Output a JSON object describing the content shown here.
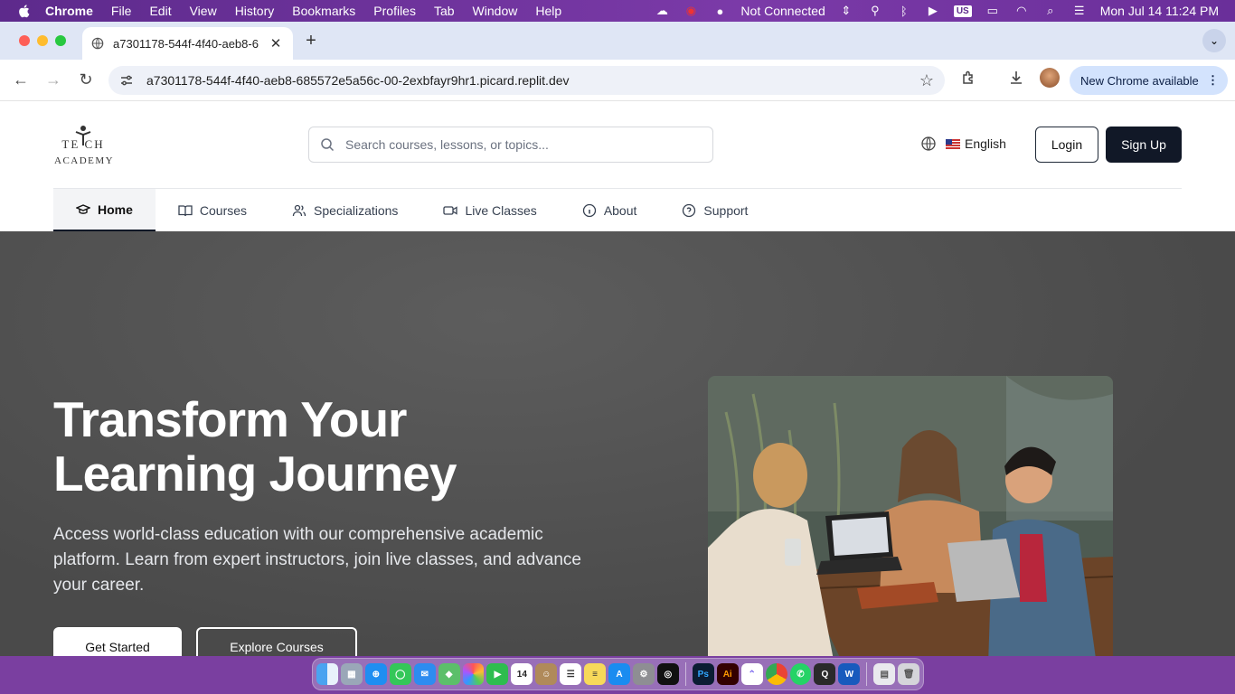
{
  "menubar": {
    "app_name": "Chrome",
    "items": [
      "File",
      "Edit",
      "View",
      "History",
      "Bookmarks",
      "Profiles",
      "Tab",
      "Window",
      "Help"
    ],
    "status_text": "Not Connected",
    "input_source": "US",
    "datetime": "Mon Jul 14  11:24 PM"
  },
  "browser": {
    "tab_title": "a7301178-544f-4f40-aeb8-6",
    "url": "a7301178-544f-4f40-aeb8-685572e5a56c-00-2exbfayr9hr1.picard.replit.dev",
    "update_label": "New Chrome available"
  },
  "site": {
    "logo_line1": "TE  CH",
    "logo_line2": "ACADEMY",
    "search_placeholder": "Search courses, lessons, or topics...",
    "language": "English",
    "login_label": "Login",
    "signup_label": "Sign Up",
    "nav": [
      {
        "label": "Home",
        "icon": "graduation-cap-icon",
        "active": true
      },
      {
        "label": "Courses",
        "icon": "book-icon"
      },
      {
        "label": "Specializations",
        "icon": "users-icon"
      },
      {
        "label": "Live Classes",
        "icon": "video-icon"
      },
      {
        "label": "About",
        "icon": "info-icon"
      },
      {
        "label": "Support",
        "icon": "help-circle-icon"
      }
    ]
  },
  "hero": {
    "title_line1": "Transform Your",
    "title_line2": "Learning Journey",
    "description": "Access world-class education with our comprehensive academic platform. Learn from expert instructors, join live classes, and advance your career.",
    "primary_cta": "Get Started",
    "secondary_cta": "Explore Courses",
    "image_icon": "students-photo"
  },
  "dock": {
    "apps": [
      "Finder",
      "Launchpad",
      "Safari",
      "Messages",
      "Mail",
      "Maps",
      "Photos",
      "FaceTime",
      "Calendar",
      "Contacts",
      "Reminders",
      "Notes",
      "App Store",
      "System Settings",
      "ChatGPT",
      "Photoshop",
      "Illustrator",
      "ClickUp",
      "Chrome",
      "WhatsApp",
      "QuickTime",
      "Word",
      "Documents",
      "Trash"
    ],
    "calendar_day": "14"
  },
  "colors": {
    "primary_dark": "#111827",
    "hero_bg": "#4f4f4f",
    "desktop_bg": "#7a3fa0"
  }
}
